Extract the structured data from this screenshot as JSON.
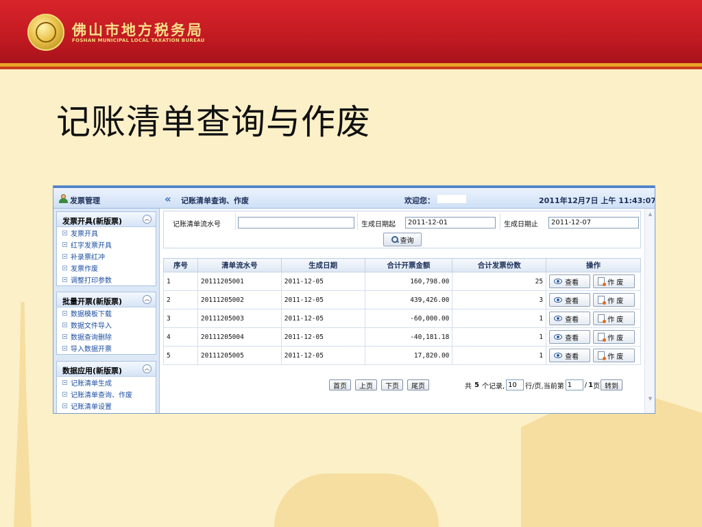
{
  "brand": {
    "name_cn": "佛山市地方税务局",
    "name_en": "FOSHAN MUNICIPAL LOCAL TAXATION BUREAU"
  },
  "slide_title": "记账清单查询与作废",
  "app": {
    "left_title": "发票管理",
    "page_title": "记账清单查询、作废",
    "welcome": "欢迎您：",
    "datetime": "2011年12月7日 上午 11:43:07"
  },
  "menus": [
    {
      "title": "发票开具(新版票)",
      "items": [
        "发票开具",
        "红字发票开具",
        "补录票红冲",
        "发票作废",
        "调整打印参数"
      ]
    },
    {
      "title": "批量开票(新版票)",
      "items": [
        "数据模板下载",
        "数据文件导入",
        "数据查询删除",
        "导入数据开票"
      ]
    },
    {
      "title": "数据应用(新版票)",
      "items": [
        "记账清单生成",
        "记账清单查询、作废",
        "记账清单设置"
      ]
    }
  ],
  "search": {
    "serial_label": "记账清单流水号",
    "serial_value": "",
    "date_from_label": "生成日期起",
    "date_from_value": "2011-12-01",
    "date_to_label": "生成日期止",
    "date_to_value": "2011-12-07",
    "query_button": "查询"
  },
  "table": {
    "headers": [
      "序号",
      "清单流水号",
      "生成日期",
      "合计开票金额",
      "合计发票份数",
      "操作"
    ],
    "rows": [
      {
        "no": "1",
        "serial": "20111205001",
        "date": "2011-12-05",
        "amount": "160,798.00",
        "count": "25"
      },
      {
        "no": "2",
        "serial": "20111205002",
        "date": "2011-12-05",
        "amount": "439,426.00",
        "count": "3"
      },
      {
        "no": "3",
        "serial": "20111205003",
        "date": "2011-12-05",
        "amount": "-60,000.00",
        "count": "1"
      },
      {
        "no": "4",
        "serial": "20111205004",
        "date": "2011-12-05",
        "amount": "-40,181.18",
        "count": "1"
      },
      {
        "no": "5",
        "serial": "20111205005",
        "date": "2011-12-05",
        "amount": "17,820.00",
        "count": "1"
      }
    ],
    "view_label": "查看",
    "void_label": "作 废"
  },
  "pager": {
    "first": "首页",
    "prev": "上页",
    "next": "下页",
    "last": "尾页",
    "total_prefix": "共",
    "total": "5",
    "total_suffix": "个记录,",
    "page_size": "10",
    "page_size_suffix": "行/页,当前第",
    "current": "1",
    "of_prefix": "/",
    "pages": "1",
    "pages_suffix": "页",
    "goto": "转到"
  }
}
